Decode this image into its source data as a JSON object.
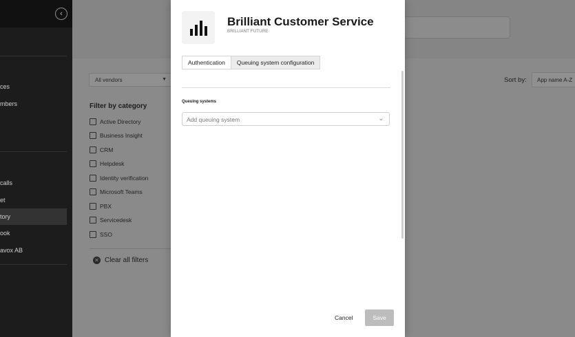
{
  "sidebar": {
    "items": [
      {
        "label": "ces"
      },
      {
        "label": "mbers"
      },
      {
        "label": "calls"
      },
      {
        "label": "et"
      },
      {
        "label": "tory"
      },
      {
        "label": "ook"
      },
      {
        "label": "avox AB"
      }
    ]
  },
  "filters": {
    "vendor_select": "All vendors",
    "title": "Filter by category",
    "categories": [
      "Active Directory",
      "Business Insight",
      "CRM",
      "Helpdesk",
      "Identity verification",
      "Microsoft Teams",
      "PBX",
      "Servicedesk",
      "SSO"
    ],
    "clear_label": "Clear all filters"
  },
  "sort": {
    "label": "Sort by:",
    "value": "App name A-Z"
  },
  "modal": {
    "title": "Brilliant Customer Service",
    "vendor": "BRILLIANT FUTURE",
    "tabs": [
      {
        "label": "Authentication",
        "active": false
      },
      {
        "label": "Queuing system configuration",
        "active": true
      }
    ],
    "section_label": "Queuing systems",
    "queue_placeholder": "Add queuing system",
    "cancel_label": "Cancel",
    "save_label": "Save"
  },
  "icons": {
    "collapse": "chevron-left-icon",
    "logo": "bar-chart-logo",
    "dropdown": "chevron-down-icon",
    "clear": "close-circle-icon"
  }
}
